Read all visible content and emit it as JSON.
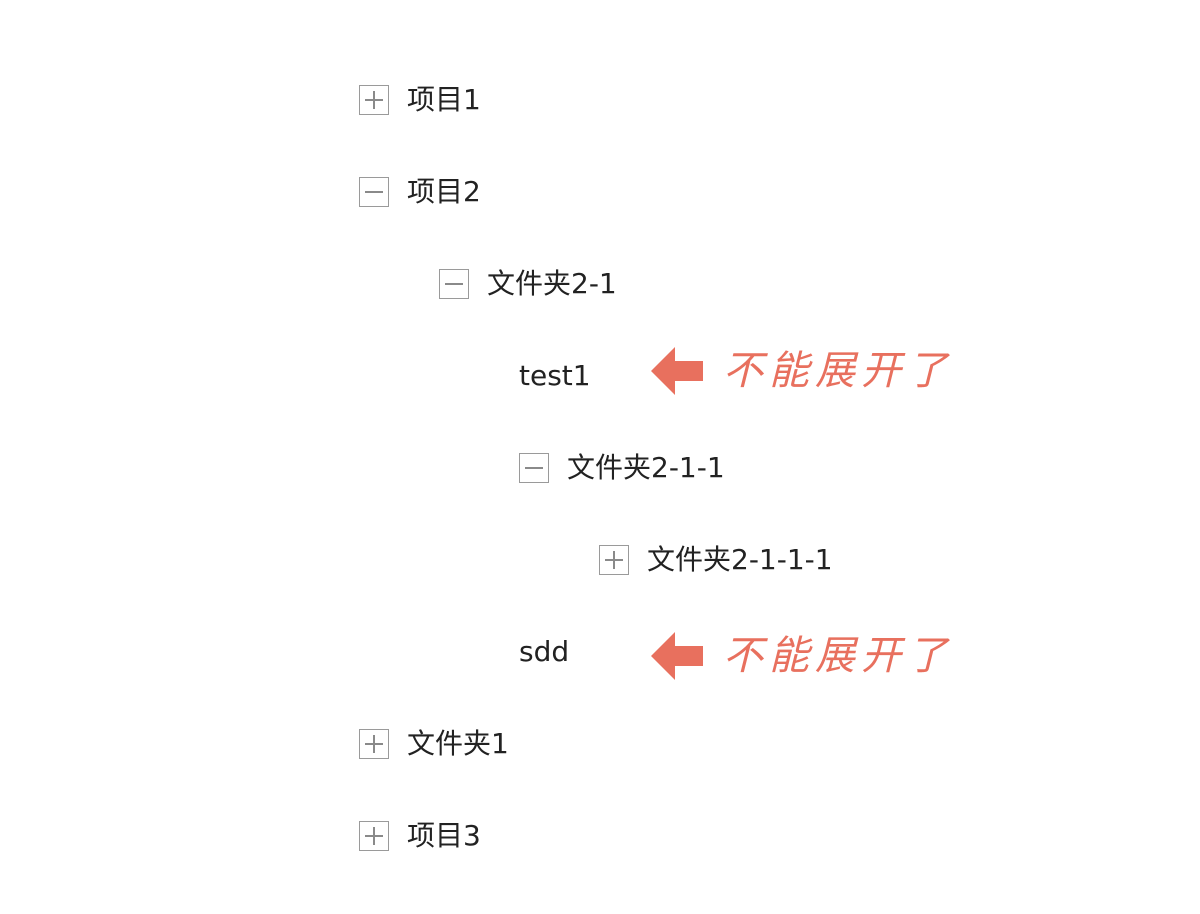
{
  "tree": {
    "item1": {
      "label": "项目1",
      "toggle": "plus"
    },
    "item2": {
      "label": "项目2",
      "toggle": "minus"
    },
    "folder2_1": {
      "label": "文件夹2-1",
      "toggle": "minus"
    },
    "test1": {
      "label": "test1"
    },
    "folder2_1_1": {
      "label": "文件夹2-1-1",
      "toggle": "minus"
    },
    "folder2_1_1_1": {
      "label": "文件夹2-1-1-1",
      "toggle": "plus"
    },
    "sdd": {
      "label": "sdd"
    },
    "folder1": {
      "label": "文件夹1",
      "toggle": "plus"
    },
    "item3": {
      "label": "项目3",
      "toggle": "plus"
    }
  },
  "annotations": {
    "test1_note": "不能展开了",
    "sdd_note": "不能展开了"
  },
  "colors": {
    "annotation": "#e8705e",
    "text": "#222222",
    "toggle_border": "#9a9a9a"
  },
  "icons": {
    "expand": "plus-square-icon",
    "collapse": "minus-square-icon",
    "annotation_arrow": "left-arrow-icon"
  }
}
